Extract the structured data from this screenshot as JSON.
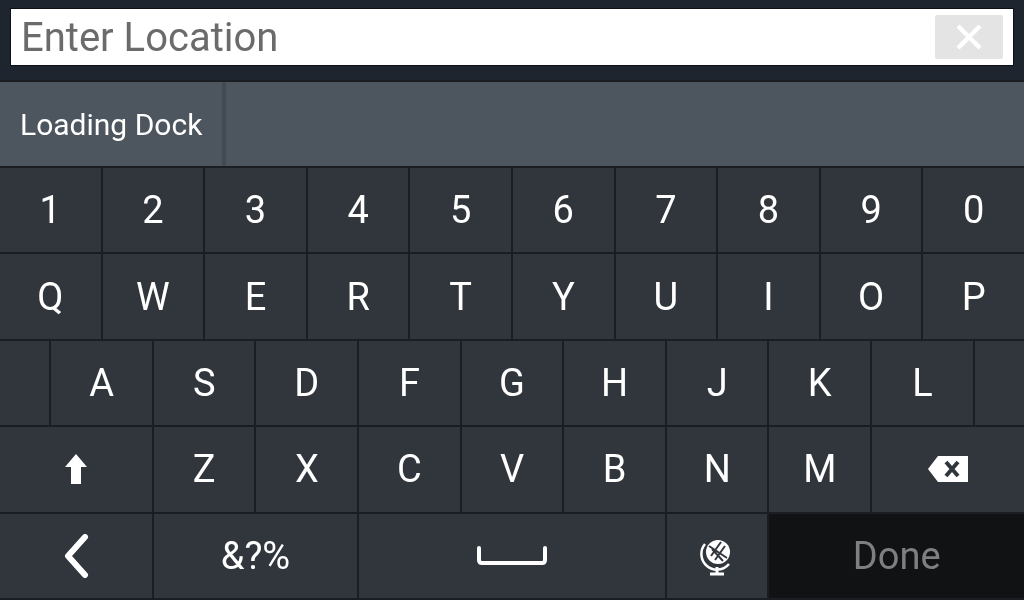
{
  "search": {
    "placeholder": "Enter Location"
  },
  "suggestions": [
    {
      "label": "Loading Dock"
    }
  ],
  "keyboard": {
    "key_rows": [
      {
        "keys": [
          {
            "kind": "char",
            "label": "1"
          },
          {
            "kind": "char",
            "label": "2"
          },
          {
            "kind": "char",
            "label": "3"
          },
          {
            "kind": "char",
            "label": "4"
          },
          {
            "kind": "char",
            "label": "5"
          },
          {
            "kind": "char",
            "label": "6"
          },
          {
            "kind": "char",
            "label": "7"
          },
          {
            "kind": "char",
            "label": "8"
          },
          {
            "kind": "char",
            "label": "9"
          },
          {
            "kind": "char",
            "label": "0"
          }
        ]
      },
      {
        "keys": [
          {
            "kind": "char",
            "label": "Q"
          },
          {
            "kind": "char",
            "label": "W"
          },
          {
            "kind": "char",
            "label": "E"
          },
          {
            "kind": "char",
            "label": "R"
          },
          {
            "kind": "char",
            "label": "T"
          },
          {
            "kind": "char",
            "label": "Y"
          },
          {
            "kind": "char",
            "label": "U"
          },
          {
            "kind": "char",
            "label": "I"
          },
          {
            "kind": "char",
            "label": "O"
          },
          {
            "kind": "char",
            "label": "P"
          }
        ]
      },
      {
        "keys": [
          {
            "kind": "blank"
          },
          {
            "kind": "char",
            "label": "A"
          },
          {
            "kind": "char",
            "label": "S"
          },
          {
            "kind": "char",
            "label": "D"
          },
          {
            "kind": "char",
            "label": "F"
          },
          {
            "kind": "char",
            "label": "G"
          },
          {
            "kind": "char",
            "label": "H"
          },
          {
            "kind": "char",
            "label": "J"
          },
          {
            "kind": "char",
            "label": "K"
          },
          {
            "kind": "char",
            "label": "L"
          },
          {
            "kind": "blank"
          }
        ]
      },
      {
        "keys": [
          {
            "kind": "shift"
          },
          {
            "kind": "char",
            "label": "Z"
          },
          {
            "kind": "char",
            "label": "X"
          },
          {
            "kind": "char",
            "label": "C"
          },
          {
            "kind": "char",
            "label": "V"
          },
          {
            "kind": "char",
            "label": "B"
          },
          {
            "kind": "char",
            "label": "N"
          },
          {
            "kind": "char",
            "label": "M"
          },
          {
            "kind": "backspace"
          }
        ]
      },
      {
        "keys": [
          {
            "kind": "back"
          },
          {
            "kind": "mode",
            "label": "&?%"
          },
          {
            "kind": "space"
          },
          {
            "kind": "globe"
          },
          {
            "kind": "action",
            "label": "Done",
            "disabled": true
          }
        ]
      }
    ]
  }
}
